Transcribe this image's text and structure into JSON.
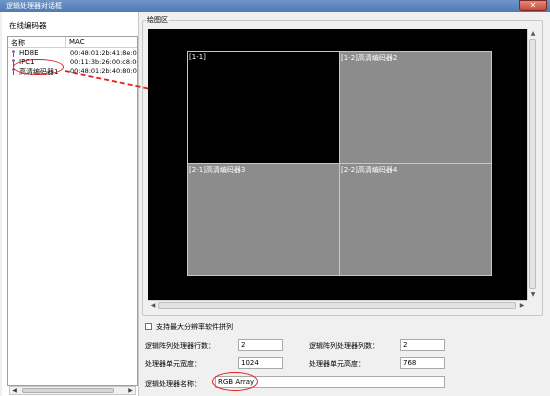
{
  "window": {
    "title": "逻辑处理器对话框",
    "close_label": "✕"
  },
  "left_panel": {
    "title": "在线编码器",
    "columns": [
      "名称",
      "MAC"
    ],
    "rows": [
      {
        "name": "HD8E",
        "mac": "00:48:01:2b:41:8e:00:00"
      },
      {
        "name": "IPC1",
        "mac": "00:11:3b:26:00:c8:00:00"
      },
      {
        "name": "高清编码器1",
        "mac": "00:48:01:2b:40:80:00:00"
      }
    ]
  },
  "canvas_group": {
    "label": "绘图区",
    "cells": [
      {
        "label": "[1-1]",
        "color": "#000000"
      },
      {
        "label": "[1-2]高清编码器2",
        "color": "#8c8c8c"
      },
      {
        "label": "[2-1]高清编码器3",
        "color": "#8c8c8c"
      },
      {
        "label": "[2-2]高清编码器4",
        "color": "#8c8c8c"
      }
    ]
  },
  "form": {
    "checkbox_label": "支持最大分辨率软件拼列",
    "rows_label": "逻辑阵列处理器行数：",
    "rows_value": "2",
    "cols_label": "逻辑阵列处理器列数：",
    "cols_value": "2",
    "width_label": "处理器单元宽度：",
    "width_value": "1024",
    "height_label": "处理器单元高度：",
    "height_value": "768",
    "name_label": "逻辑处理器名称：",
    "name_value": "RGB Array"
  },
  "colors": {
    "annotation": "#e02020",
    "canvas_bg": "#000000",
    "cell_gray": "#8c8c8c"
  }
}
